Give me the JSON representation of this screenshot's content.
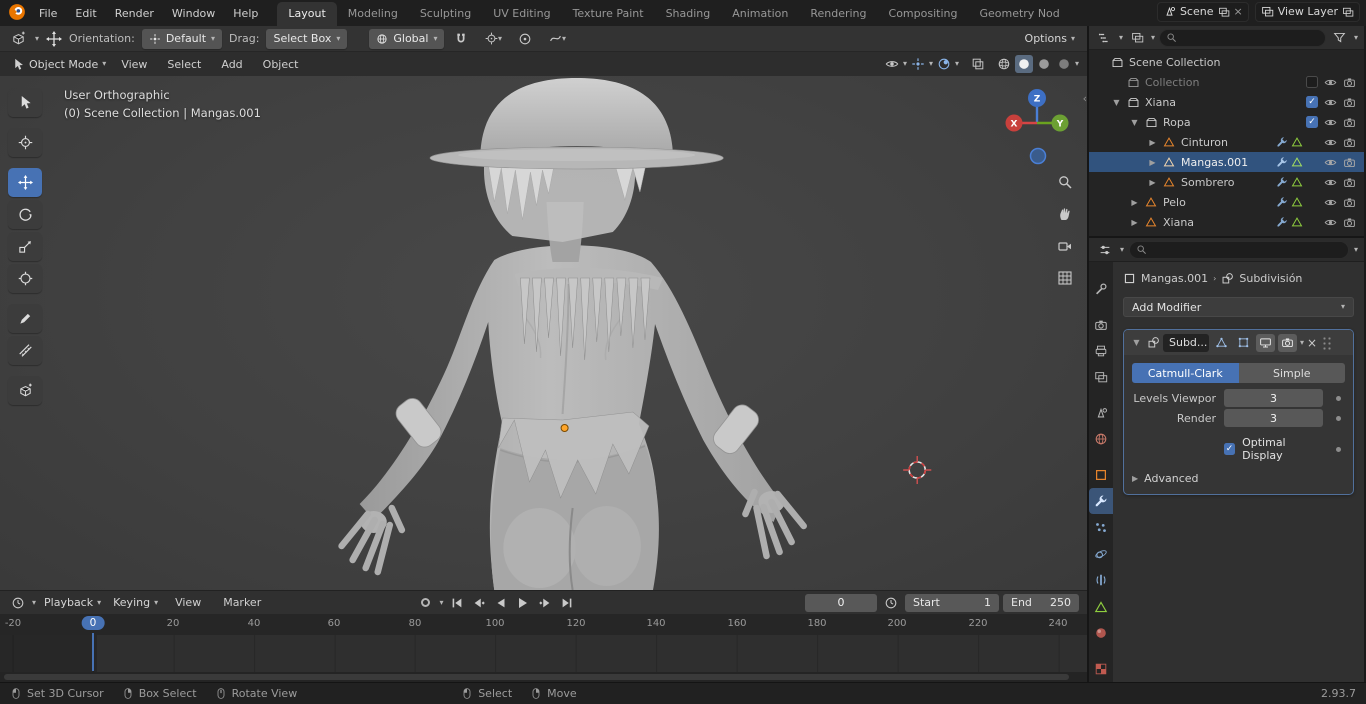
{
  "icons": {
    "chevron_down": "▾",
    "chevron_right": "▸",
    "tri_down": "▼",
    "tri_right": "▶",
    "close": "×",
    "check": "✓",
    "collapse_left": "‹",
    "breadcrumb_sep": "›"
  },
  "topbar": {
    "menus": [
      "File",
      "Edit",
      "Render",
      "Window",
      "Help"
    ],
    "workspaces": [
      "Layout",
      "Modeling",
      "Sculpting",
      "UV Editing",
      "Texture Paint",
      "Shading",
      "Animation",
      "Rendering",
      "Compositing",
      "Geometry Nod"
    ],
    "scene_label": "Scene",
    "view_layer_label": "View Layer"
  },
  "tool_settings": {
    "orientation_label": "Orientation:",
    "orientation_value": "Default",
    "drag_label": "Drag:",
    "drag_value": "Select Box",
    "transform_space": "Global",
    "options_label": "Options"
  },
  "viewport": {
    "mode": "Object Mode",
    "menus": [
      "View",
      "Select",
      "Add",
      "Object"
    ],
    "overlay_line1": "User Orthographic",
    "overlay_line2": "(0) Scene Collection | Mangas.001",
    "axis_x": "X",
    "axis_y": "Y",
    "axis_z": "Z"
  },
  "outliner": {
    "rows": [
      {
        "label": "Scene Collection"
      },
      {
        "label": "Collection"
      },
      {
        "label": "Xiana"
      },
      {
        "label": "Ropa"
      },
      {
        "label": "Cinturon"
      },
      {
        "label": "Mangas.001"
      },
      {
        "label": "Sombrero"
      },
      {
        "label": "Pelo"
      },
      {
        "label": "Xiana"
      }
    ]
  },
  "properties": {
    "breadcrumb_object": "Mangas.001",
    "breadcrumb_modifier": "Subdivisión",
    "add_modifier_label": "Add Modifier",
    "modifier": {
      "name": "Subd...",
      "type_catmull": "Catmull-Clark",
      "type_simple": "Simple",
      "levels_label": "Levels Viewpor",
      "levels_value": "3",
      "render_label": "Render",
      "render_value": "3",
      "optimal_label": "Optimal Display",
      "advanced_label": "Advanced"
    }
  },
  "timeline": {
    "menus": [
      "Playback",
      "Keying",
      "View",
      "Marker"
    ],
    "frame_current": "0",
    "start_label": "Start",
    "start_value": "1",
    "end_label": "End",
    "end_value": "250",
    "ticks": [
      "-20",
      "0",
      "20",
      "40",
      "60",
      "80",
      "100",
      "120",
      "140",
      "160",
      "180",
      "200",
      "220",
      "240"
    ]
  },
  "statusbar": {
    "hints": [
      "Set 3D Cursor",
      "Box Select",
      "Rotate View",
      "Select",
      "Move"
    ],
    "version": "2.93.7"
  }
}
